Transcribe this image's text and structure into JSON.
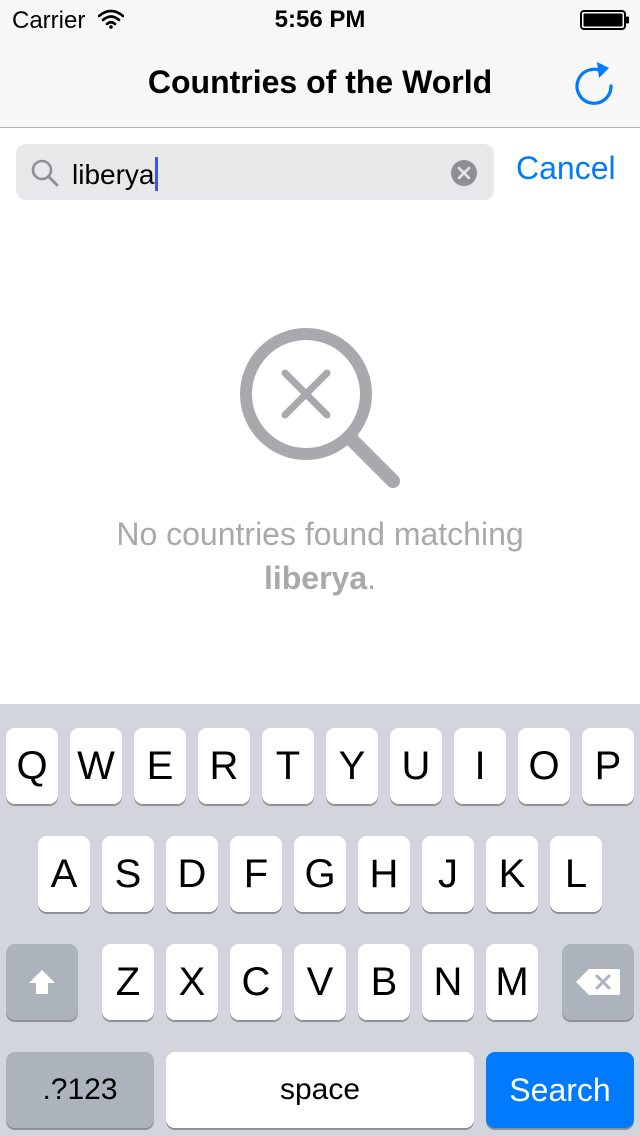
{
  "status_bar": {
    "carrier": "Carrier",
    "time": "5:56 PM"
  },
  "nav": {
    "title": "Countries of the World",
    "refresh_icon": "refresh-icon"
  },
  "search": {
    "value": "liberya",
    "cancel_label": "Cancel"
  },
  "empty_state": {
    "icon": "no-results-magnifier-icon",
    "message_prefix": "No countries found matching",
    "query": "liberya",
    "suffix": "."
  },
  "keyboard": {
    "row1": [
      "Q",
      "W",
      "E",
      "R",
      "T",
      "Y",
      "U",
      "I",
      "O",
      "P"
    ],
    "row2": [
      "A",
      "S",
      "D",
      "F",
      "G",
      "H",
      "J",
      "K",
      "L"
    ],
    "row3": [
      "Z",
      "X",
      "C",
      "V",
      "B",
      "N",
      "M"
    ],
    "numbers_label": ".?123",
    "space_label": "space",
    "return_label": "Search"
  },
  "colors": {
    "accent": "#007aff",
    "keyboard_bg": "#d2d5db",
    "muted_text": "#a9a9ad"
  }
}
